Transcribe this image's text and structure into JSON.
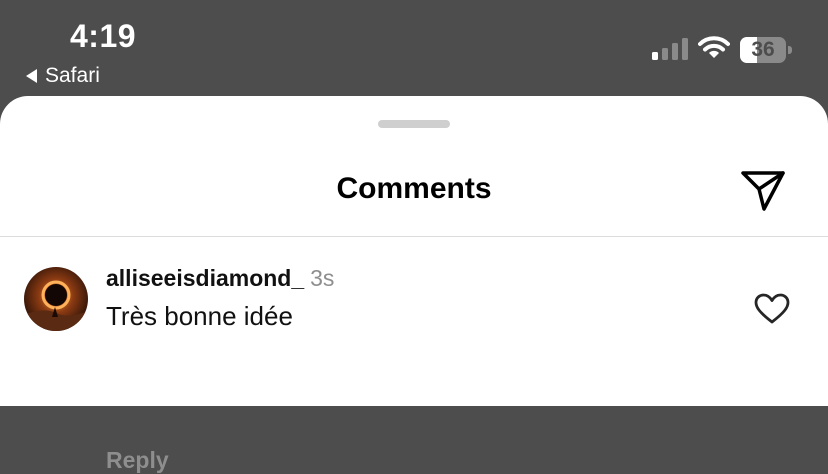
{
  "status_bar": {
    "time": "4:19",
    "back_label": "Safari",
    "battery_level": "36",
    "battery_fraction": 0.36,
    "signal_icon": "cellular-signal-icon",
    "wifi_icon": "wifi-icon"
  },
  "sheet": {
    "title": "Comments",
    "send_icon": "paper-plane-icon"
  },
  "comments": [
    {
      "username": "alliseeisdiamond_",
      "time_ago": "3s",
      "text": "Très bonne idée",
      "reply_label": "Reply",
      "like_icon": "heart-outline-icon"
    }
  ],
  "colors": {
    "status_bar_bg": "#4d4d4d",
    "sheet_bg": "#ffffff",
    "muted_text": "#8e8e8e"
  }
}
